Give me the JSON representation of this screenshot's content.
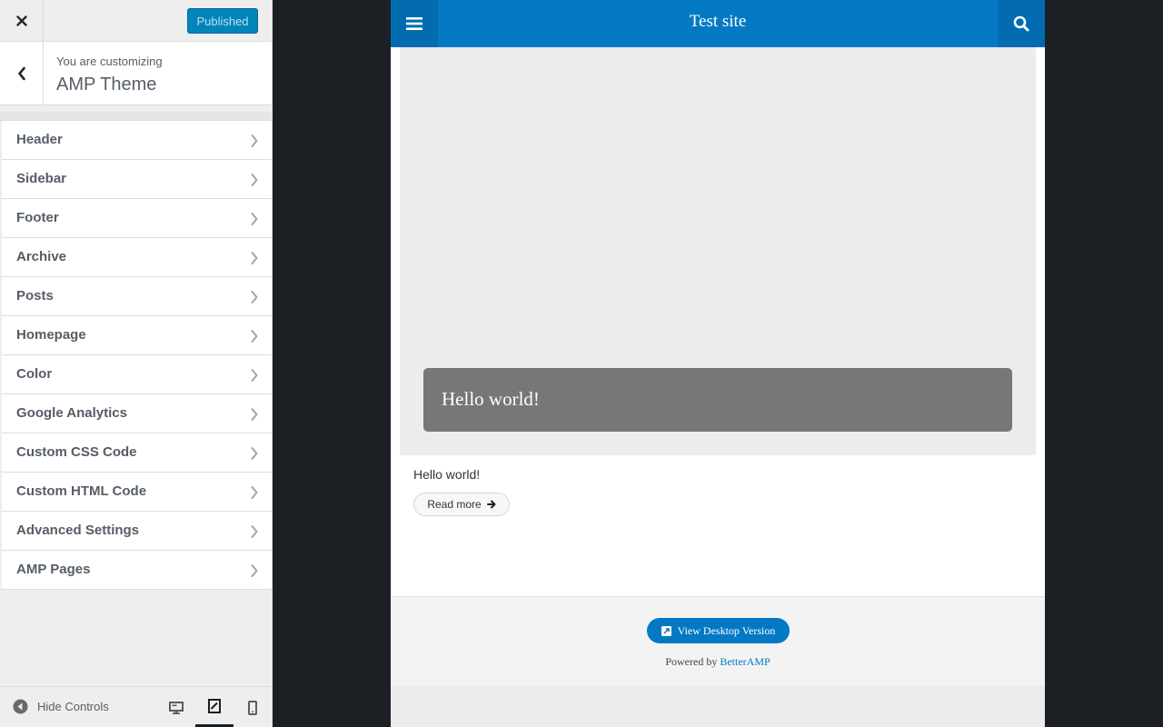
{
  "customizer": {
    "close_icon": "close-icon",
    "publish_label": "Published",
    "back_icon": "chevron-left-icon",
    "customizing_label": "You are customizing",
    "theme_name": "AMP Theme",
    "panels": [
      {
        "label": "Header"
      },
      {
        "label": "Sidebar"
      },
      {
        "label": "Footer"
      },
      {
        "label": "Archive"
      },
      {
        "label": "Posts"
      },
      {
        "label": "Homepage"
      },
      {
        "label": "Color"
      },
      {
        "label": "Google Analytics"
      },
      {
        "label": "Custom CSS Code"
      },
      {
        "label": "Custom HTML Code"
      },
      {
        "label": "Advanced Settings"
      },
      {
        "label": "AMP Pages"
      }
    ],
    "footer": {
      "hide_controls_label": "Hide Controls",
      "devices": [
        "desktop",
        "tablet",
        "mobile"
      ],
      "active_device": "tablet"
    }
  },
  "preview": {
    "site_title": "Test site",
    "featured_title": "Hello world!",
    "excerpt": "Hello world!",
    "read_more_label": "Read more",
    "view_desktop_label": "View Desktop Version",
    "powered_by": "Powered by",
    "powered_link": "BetterAMP"
  },
  "colors": {
    "brand_blue": "#0379c4",
    "publish_blue": "#0085ba",
    "preview_backdrop": "#1c1f24"
  }
}
